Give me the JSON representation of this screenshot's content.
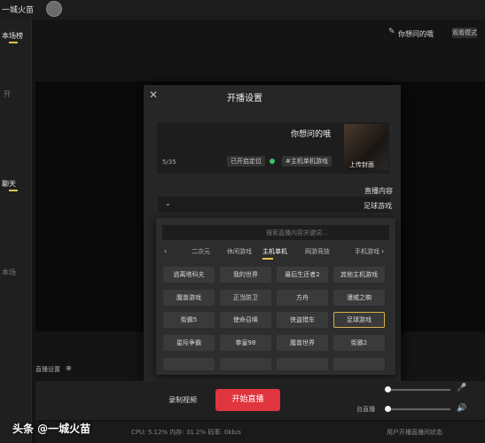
{
  "topbar": {
    "title": "一城火苗"
  },
  "left": {
    "tab1": "本场榜",
    "tab2": "聊天",
    "side_text1": "开",
    "side_text2": "本场"
  },
  "header": {
    "preview_title": "你想问的哦",
    "badge": "观看模式"
  },
  "modal": {
    "title": "开播设置",
    "close": "✕",
    "stream_name": "你想问的哦",
    "cover_label": "上传封面",
    "tag1": "#主机单机游戏",
    "tag2": "已开启定位",
    "counter": "5/35",
    "content_label": "直播内容",
    "select_value": "足球游戏",
    "search_placeholder": "搜索直播内容关键词...",
    "categories": [
      "手机游戏",
      "网游竞技",
      "主机单机",
      "休闲游戏",
      "二次元"
    ],
    "active_category": "主机单机",
    "games": [
      [
        "其他主机游戏",
        "最后生还者2",
        "我的世界",
        "逃离塔科夫"
      ],
      [
        "漫威之蜘",
        "方舟",
        "正当防卫",
        "魔兽游戏"
      ],
      [
        "足球游戏",
        "侠盗猎车",
        "使命召唤",
        "街霸5"
      ],
      [
        "街霸2",
        "魔兽世界",
        "拳皇98",
        "星际争霸"
      ],
      [
        "",
        "",
        "",
        ""
      ]
    ]
  },
  "status": {
    "label": "直播设置",
    "icon": "⊕"
  },
  "bottom": {
    "start": "开始直播",
    "record": "录制视频",
    "speaker_label": "台直播",
    "mic_icon": "🎤",
    "spk_icon": "🔊",
    "footer_left": "CPU: 5.12%  内存: 31.2%  码率: 0kb/s",
    "footer_right": "用户开播直播间状态",
    "watermark": "头条 @一城火苗"
  }
}
